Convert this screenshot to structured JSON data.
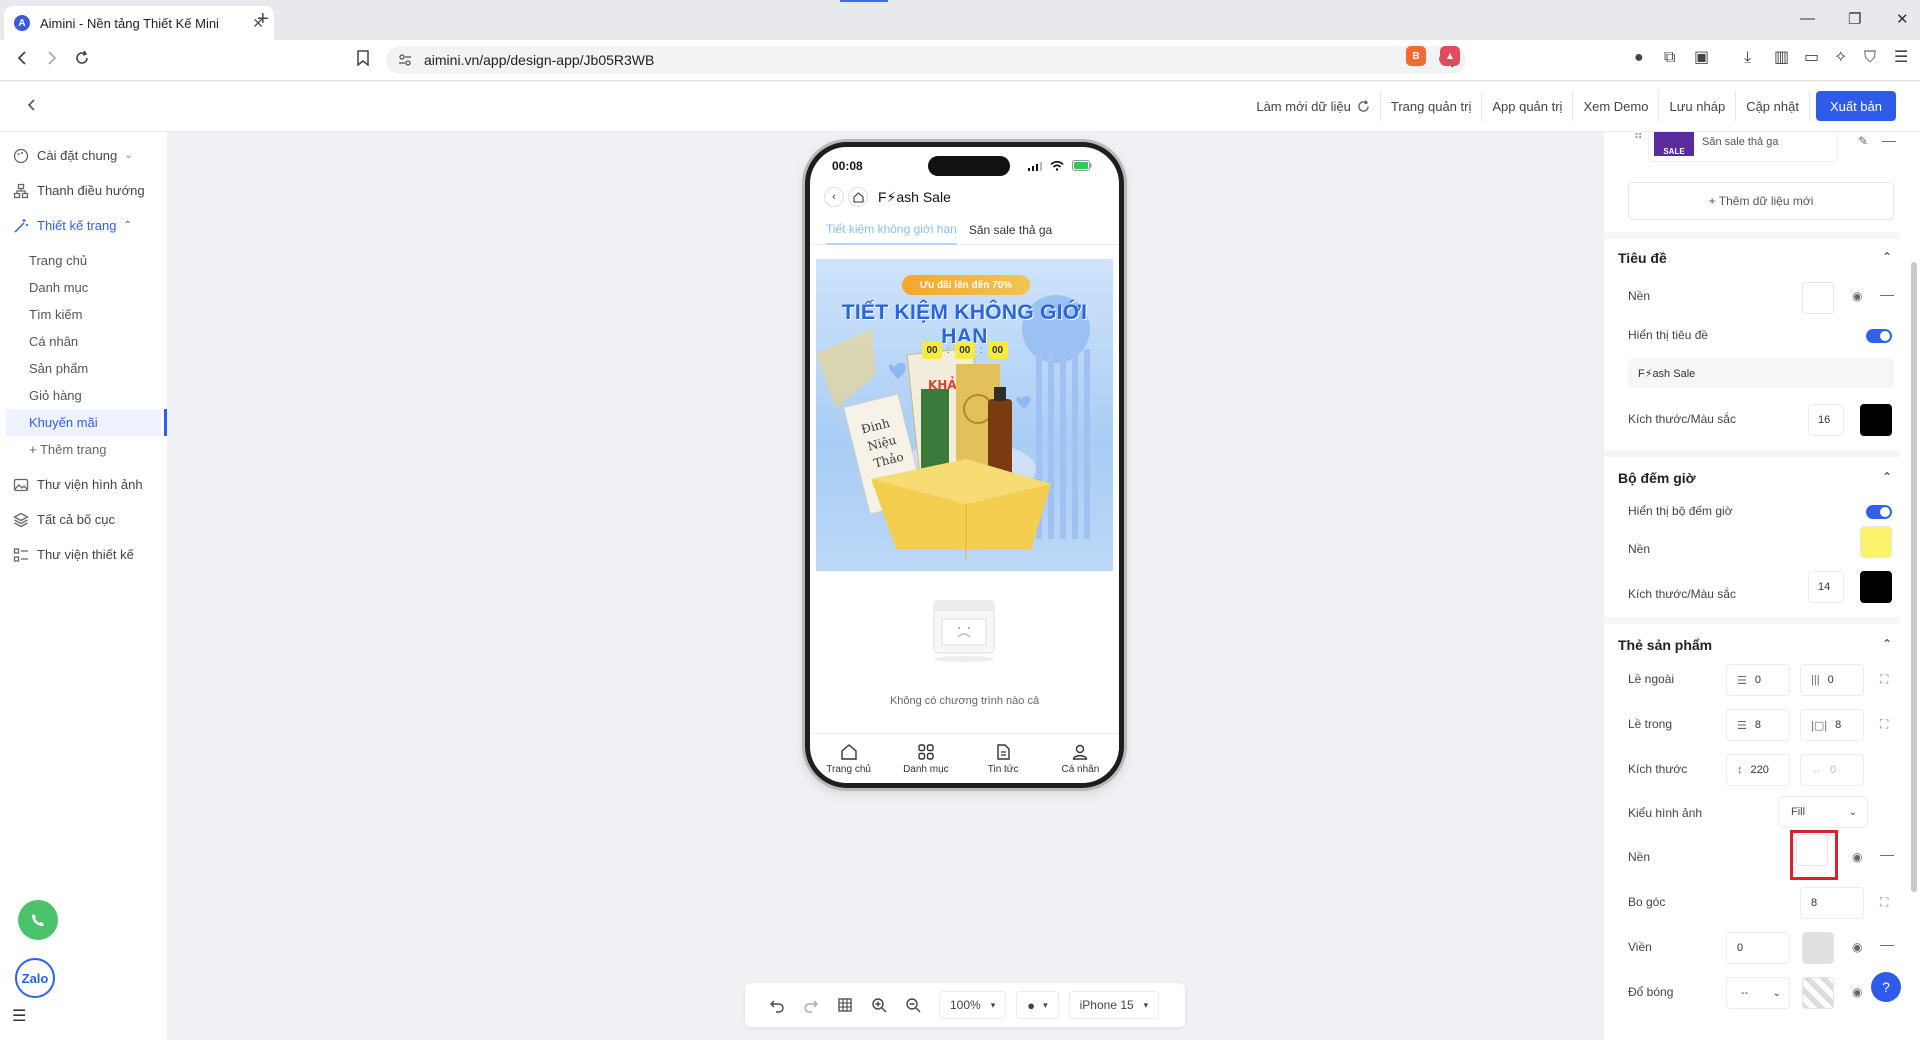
{
  "browser": {
    "tab_title": "Aimini - Nền tảng Thiết Kế Mini",
    "url": "aimini.vn/app/design-app/Jb05R3WB"
  },
  "header": {
    "actions": {
      "refresh": "Làm mới dữ liệu",
      "admin_page": "Trang quản trị",
      "admin_app": "App quản trị",
      "demo": "Xem Demo",
      "draft": "Lưu nháp",
      "update": "Cập nhật",
      "publish": "Xuất bản"
    }
  },
  "sidebar": {
    "general": "Cài đặt chung",
    "nav_bar": "Thanh điều hướng",
    "page_design": "Thiết kế trang",
    "pages": [
      "Trang chủ",
      "Danh mục",
      "Tìm kiếm",
      "Cá nhân",
      "Sản phẩm",
      "Giỏ hàng",
      "Khuyến mãi"
    ],
    "add_page": "+ Thêm trang",
    "image_library": "Thư viện hình ảnh",
    "all_layouts": "Tất cả bố cục",
    "design_library": "Thư viện thiết kế",
    "zalo": "Zalo"
  },
  "phone": {
    "time": "00:08",
    "title": "F⚡ash Sale",
    "tabs": [
      "Tiết kiệm không giới hạn",
      "Săn sale thả ga"
    ],
    "banner": {
      "promo": "Ưu đãi lên đến 70%",
      "headline": "TIẾT KIỆM KHÔNG GIỚI HẠN",
      "hours": "00",
      "minutes": "00",
      "seconds": "00",
      "sep": ":"
    },
    "empty_message": "Không có chương trình nào cả",
    "bottom_nav": [
      "Trang chủ",
      "Danh mục",
      "Tin tức",
      "Cá nhân"
    ]
  },
  "toolbar": {
    "zoom": "100%",
    "device": "iPhone 15"
  },
  "panel": {
    "data_item": "Săn sale thả ga",
    "add_data": "+ Thêm dữ liệu mới",
    "title_section": {
      "heading": "Tiêu đề",
      "background": "Nền",
      "show_title": "Hiển thị tiêu đề",
      "title_value": "F⚡ash Sale",
      "size_color": "Kích thước/Màu sắc",
      "size": "16"
    },
    "timer_section": {
      "heading": "Bộ đếm giờ",
      "show_timer": "Hiển thị bộ đếm giờ",
      "background": "Nền",
      "size_color": "Kích thước/Màu sắc",
      "size": "14"
    },
    "card_section": {
      "heading": "Thẻ sản phẩm",
      "margin": "Lề ngoài",
      "margin_v": "0",
      "margin_h": "0",
      "padding": "Lề trong",
      "padding_v": "8",
      "padding_h": "8",
      "size": "Kích thước",
      "size_h": "220",
      "size_w": "0",
      "image_style": "Kiểu hình ảnh",
      "image_style_value": "Fill",
      "background": "Nền",
      "radius": "Bo góc",
      "radius_value": "8",
      "border": "Viền",
      "border_value": "0",
      "shadow": "Đổ bóng",
      "shadow_value": "--"
    }
  },
  "colors": {
    "primary": "#2f5bea",
    "timer_bg": "#fbf46a",
    "black": "#000000",
    "highlight": "#d9232a"
  }
}
